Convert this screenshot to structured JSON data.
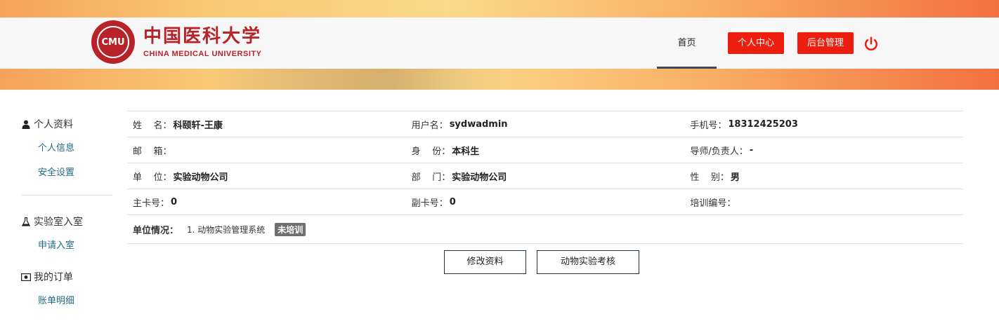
{
  "header": {
    "logo_seal_text": "CMU",
    "logo_cn": "中国医科大学",
    "logo_en": "CHINA MEDICAL UNIVERSITY",
    "nav_home": "首页",
    "btn_personal_center": "个人中心",
    "btn_admin": "后台管理",
    "power_icon": "power-icon",
    "accent_color": "#ee1e0f"
  },
  "sidebar": {
    "groups": [
      {
        "title": "个人资料",
        "icon": "user-icon",
        "items": [
          "个人信息",
          "安全设置"
        ]
      },
      {
        "title": "实验室入室",
        "icon": "flask-icon",
        "items": [
          "申请入室"
        ]
      },
      {
        "title": "我的订单",
        "icon": "money-icon",
        "items": [
          "账单明细"
        ]
      }
    ]
  },
  "profile": {
    "rows": [
      [
        {
          "label": "姓    名：",
          "value": "科颐轩-王康"
        },
        {
          "label": "用户名：",
          "value": "sydwadmin"
        },
        {
          "label": "手机号：",
          "value": "18312425203"
        }
      ],
      [
        {
          "label": "邮    箱：",
          "value": ""
        },
        {
          "label": "身    份：",
          "value": "本科生"
        },
        {
          "label": "导师/负责人：",
          "value": "-"
        }
      ],
      [
        {
          "label": "单    位：",
          "value": "实验动物公司"
        },
        {
          "label": "部    门：",
          "value": "实验动物公司"
        },
        {
          "label": "性    别：",
          "value": "男"
        }
      ],
      [
        {
          "label": "主卡号：",
          "value": "0"
        },
        {
          "label": "副卡号：",
          "value": "0"
        },
        {
          "label": "培训编号：",
          "value": ""
        }
      ]
    ],
    "unit_status_label": "单位情况：",
    "unit_item": "1. 动物实验管理系统",
    "unit_badge": "未培训"
  },
  "actions": {
    "edit_label": "修改资料",
    "exam_label": "动物实验考核"
  }
}
